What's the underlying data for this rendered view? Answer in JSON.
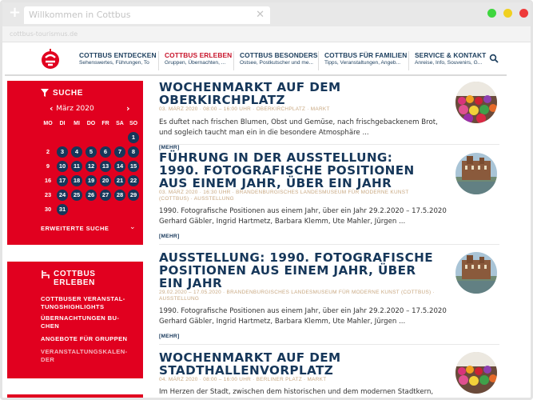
{
  "browser": {
    "tab_title": "Willkommen in Cottbus",
    "url": "cottbus-tourismus.de"
  },
  "nav": {
    "items": [
      {
        "title": "COTTBUS ENTDECKEN",
        "sub": "Sehenswertes, Führungen, To...",
        "active": false
      },
      {
        "title": "COTTBUS ERLEBEN",
        "sub": "Gruppen, Übernachten, ...",
        "active": true
      },
      {
        "title": "COTTBUS BESONDERS",
        "sub": "Ostsee, Postkutscher und me...",
        "active": false
      },
      {
        "title": "COTTBUS FÜR FAMILIEN",
        "sub": "Tipps, Veranstaltungen, Angeb...",
        "active": false
      },
      {
        "title": "SERVICE & KONTAKT",
        "sub": "Anreise, Info, Souvenirs, G...",
        "active": false
      }
    ]
  },
  "search_box": {
    "heading": "SUCHE",
    "month": "März 2020",
    "prev": "‹",
    "next": "›",
    "weekdays": [
      "MO",
      "DI",
      "MI",
      "DO",
      "FR",
      "SA",
      "SO"
    ],
    "days": [
      {
        "d": "1",
        "ev": true
      },
      {
        "d": "2",
        "ev": false
      },
      {
        "d": "3",
        "ev": true
      },
      {
        "d": "4",
        "ev": true
      },
      {
        "d": "5",
        "ev": true
      },
      {
        "d": "6",
        "ev": true
      },
      {
        "d": "7",
        "ev": true
      },
      {
        "d": "8",
        "ev": true
      },
      {
        "d": "9",
        "ev": false
      },
      {
        "d": "10",
        "ev": true
      },
      {
        "d": "11",
        "ev": true
      },
      {
        "d": "12",
        "ev": true
      },
      {
        "d": "13",
        "ev": true
      },
      {
        "d": "14",
        "ev": true
      },
      {
        "d": "15",
        "ev": true
      },
      {
        "d": "16",
        "ev": false
      },
      {
        "d": "17",
        "ev": true
      },
      {
        "d": "18",
        "ev": true
      },
      {
        "d": "19",
        "ev": true
      },
      {
        "d": "20",
        "ev": true
      },
      {
        "d": "21",
        "ev": true
      },
      {
        "d": "22",
        "ev": true
      },
      {
        "d": "23",
        "ev": false
      },
      {
        "d": "24",
        "ev": true
      },
      {
        "d": "25",
        "ev": true
      },
      {
        "d": "26",
        "ev": true
      },
      {
        "d": "27",
        "ev": true
      },
      {
        "d": "28",
        "ev": true
      },
      {
        "d": "29",
        "ev": true
      },
      {
        "d": "30",
        "ev": false
      },
      {
        "d": "31",
        "ev": true
      }
    ],
    "advanced": "ERWEITERTE SUCHE"
  },
  "erleben_box": {
    "heading_line1": "COTTBUS",
    "heading_line2": "ERLEBEN",
    "links": [
      {
        "line1": "COTTBUSER VERANSTAL-",
        "line2": "TUNGSHIGHLIGHTS",
        "current": false
      },
      {
        "line1": "ÜBERNACHTUNGEN BU-",
        "line2": "CHEN",
        "current": false
      },
      {
        "line1": "ANGEBOTE FÜR GRUPPEN",
        "line2": "",
        "current": false
      },
      {
        "line1": "VERANSTALTUNGSKALEN-",
        "line2": "DER",
        "current": true
      }
    ]
  },
  "articles": [
    {
      "title": "WOCHENMARKT AUF DEM OBERKIRCHPLATZ",
      "meta": "03. MÄRZ 2020  ·  08:00 – 16:00 UHR  ·  OBERKIRCHPLATZ  ·  MARKT",
      "text": "Es duftet nach frischen Blumen, Obst und Gemüse, nach frischgebackenem Brot, und sogleich taucht man ein in die besondere Atmosphäre ...",
      "more": "[MEHR]",
      "image": "market"
    },
    {
      "title": "FÜHRUNG IN DER AUSSTELLUNG: 1990. FOTOGRAFISCHE POSITIONEN AUS EINEM JAHR, ÜBER EIN JAHR",
      "meta": "03. MÄRZ 2020  ·  16:30 UHR  ·  BRANDENBURGISCHES LANDESMUSEUM FÜR MODERNE KUNST (COTTBUS)  ·  AUSSTELLUNG",
      "text": "1990. Fotografische Positionen aus einem Jahr, über ein Jahr 29.2.2020 – 17.5.2020 Gerhard Gäbler, Ingrid Hartmetz, Barbara Klemm, Ute Mahler, Jürgen ...",
      "more": "[MEHR]",
      "image": "museum"
    },
    {
      "title": "AUSSTELLUNG: 1990. FOTOGRAFISCHE POSITIONEN AUS EINEM JAHR, ÜBER EIN JAHR",
      "meta": "29.02.2020 – 17.05.2020  ·  BRANDENBURGISCHES LANDESMUSEUM FÜR MODERNE KUNST (COTTBUS)  ·  AUSSTELLUNG",
      "text": "1990. Fotografische Positionen aus einem Jahr, über ein Jahr 29.2.2020 – 17.5.2020 Gerhard Gäbler, Ingrid Hartmetz, Barbara Klemm, Ute Mahler, Jürgen ...",
      "more": "[MEHR]",
      "image": "museum"
    },
    {
      "title": "WOCHENMARKT AUF DEM STADTHALLENVORPLATZ",
      "meta": "04. MÄRZ 2020  ·  08:00 – 16:00 UHR  ·  BERLINER PLATZ  ·  MARKT",
      "text": "Im Herzen der Stadt, zwischen dem historischen und dem modernen Stadtkern, findet",
      "more": "",
      "image": "market"
    }
  ],
  "colors": {
    "brand_red": "#e1001f",
    "navy": "#16375a",
    "meta_tan": "#c8a882"
  }
}
